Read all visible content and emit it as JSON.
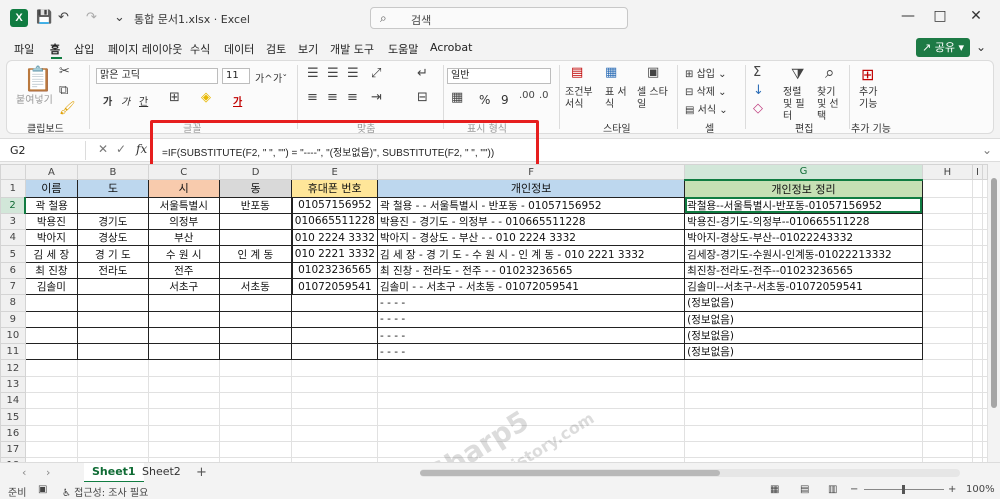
{
  "titlebar": {
    "logo": "X",
    "save_icon": "💾",
    "undo_icon": "↶",
    "redo_icon": "↷",
    "more_icon": "⌄",
    "title": "통합 문서1.xlsx  ·  Excel",
    "search_icon": "⌕",
    "search_placeholder": "검색",
    "minimize": "—",
    "maximize": "□",
    "close": "✕"
  },
  "menu": {
    "items": [
      "파일",
      "홈",
      "삽입",
      "페이지 레이아웃",
      "수식",
      "데이터",
      "검토",
      "보기",
      "개발 도구",
      "도움말",
      "Acrobat"
    ],
    "active": "홈",
    "share_label": "공유",
    "share_icon": "↗",
    "share_caret": "▾"
  },
  "ribbon": {
    "clipboard": {
      "paste": "붙여넣기",
      "label": "클립보드"
    },
    "font": {
      "name": "맑은 고딕",
      "size": "11",
      "grow": "가^",
      "shrink": "가ˇ",
      "bold": "가",
      "italic": "가",
      "underline": "간",
      "label": "글꼴"
    },
    "align": {
      "label": "맞춤"
    },
    "number": {
      "format": "일반",
      "percent": "%",
      "comma": "9",
      "label": "표시 형식"
    },
    "style": {
      "cond": "조건부 서식",
      "table": "표 서식",
      "cell": "셀 스타일",
      "label": "스타일"
    },
    "cells": {
      "insert": "삽입",
      "delete": "삭제",
      "format": "서식",
      "label": "셀"
    },
    "edit": {
      "sort": "정렬 및 필터",
      "find": "찾기 및 선택",
      "label": "편집"
    },
    "addins": {
      "add": "추가 기능",
      "label": "추가 기능"
    }
  },
  "formula": {
    "namebox": "G2",
    "cancel": "✕",
    "enter": "✓",
    "fx": "fx",
    "text": "=IF(SUBSTITUTE(F2, \" \", \"\") = \"----\", \"(정보없음)\", SUBSTITUTE(F2, \" \", \"\"))"
  },
  "sheet": {
    "columns": [
      "A",
      "B",
      "C",
      "D",
      "E",
      "F",
      "G",
      "H",
      "I"
    ],
    "headers": [
      "이름",
      "도",
      "시",
      "동",
      "휴대폰 번호",
      "개인정보",
      "개인정보 정리"
    ],
    "header_colors": [
      "#bdd7ee",
      "#bdd7ee",
      "#f8cbad",
      "#d9d9d9",
      "#ffe699",
      "#bdd7ee",
      "#c6e0b4"
    ],
    "rows": [
      [
        "곽 철용",
        "",
        "서울특별시",
        "반포동",
        "01057156952",
        "곽 철용 -  - 서울특별시 - 반포동 - 01057156952",
        "곽철용--서울특별시-반포동-01057156952"
      ],
      [
        "박용진",
        "경기도",
        "의정부",
        "",
        "010665511228",
        "박용진 - 경기도 - 의정부 -  - 010665511228",
        "박용진-경기도-의정부--010665511228"
      ],
      [
        "박아지",
        "경상도",
        "부산",
        "",
        "010 2224 3332",
        "박아지 - 경상도 - 부산 -  - 010 2224 3332",
        "박아지-경상도-부산--01022243332"
      ],
      [
        "김 세 장",
        "경 기 도",
        "수 원 시",
        "인 계 동",
        "010 2221 3332",
        "김 세 장 - 경 기 도 - 수 원 시 - 인 계 동 - 010 2221 3332",
        "김세장-경기도-수원시-인계동-01022213332"
      ],
      [
        "최 진창",
        "전라도",
        "전주",
        "",
        "01023236565",
        "최 진창 - 전라도 - 전주 -  - 01023236565",
        "최진창-전라도-전주--01023236565"
      ],
      [
        "김솔미",
        "",
        "서초구",
        "서초동",
        "01072059541",
        "김솔미 -  - 서초구 - 서초동 - 01072059541",
        "김솔미--서초구-서초동-01072059541"
      ],
      [
        "",
        "",
        "",
        "",
        "",
        "  -   -   -   -",
        "(정보없음)"
      ],
      [
        "",
        "",
        "",
        "",
        "",
        "  -   -   -   -",
        "(정보없음)"
      ],
      [
        "",
        "",
        "",
        "",
        "",
        "  -   -   -   -",
        "(정보없음)"
      ],
      [
        "",
        "",
        "",
        "",
        "",
        "  -   -   -   -",
        "(정보없음)"
      ]
    ],
    "row_numbers": [
      "1",
      "2",
      "3",
      "4",
      "5",
      "6",
      "7",
      "8",
      "9",
      "10",
      "11",
      "12",
      "13",
      "14",
      "15",
      "16",
      "17",
      "18"
    ]
  },
  "tabs": {
    "prev": "‹",
    "next": "›",
    "items": [
      "Sheet1",
      "Sheet2"
    ],
    "active": "Sheet1",
    "add": "+"
  },
  "status": {
    "ready": "준비",
    "accessibility": "접근성: 조사 필요",
    "zoom_out": "−",
    "zoom_in": "+",
    "zoom": "100%"
  },
  "colors": {
    "accent": "#107c41",
    "highlight_box": "#e61e1e"
  }
}
